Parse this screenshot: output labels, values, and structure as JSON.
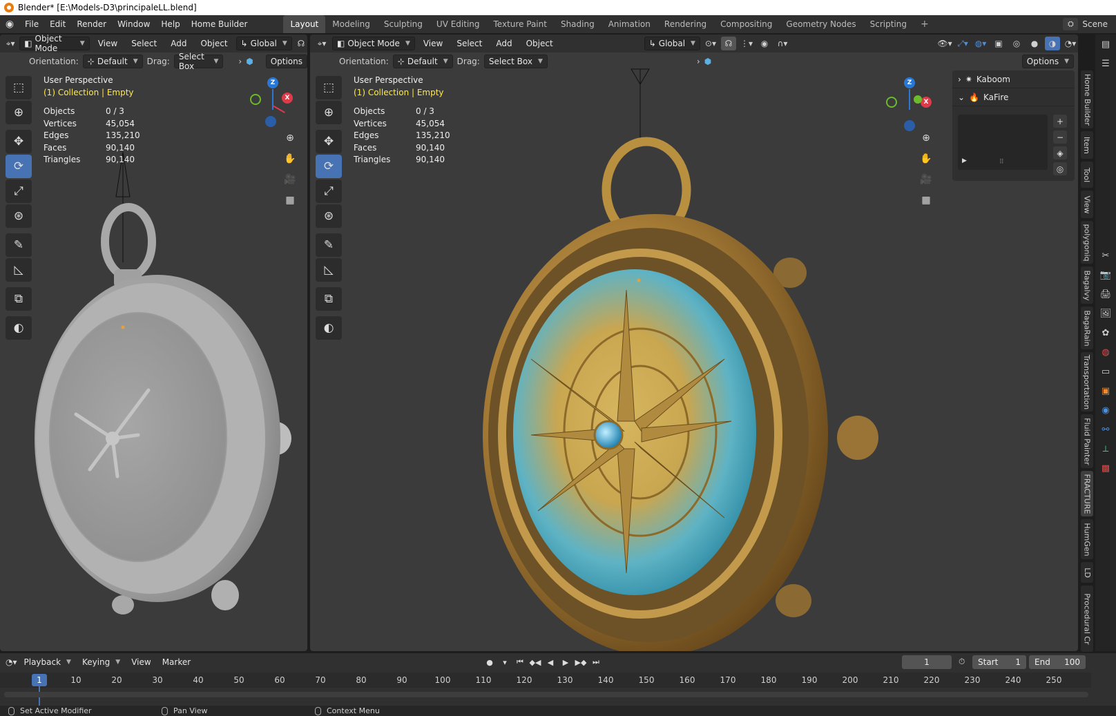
{
  "window_title": "Blender* [E:\\Models-D3\\principaleLL.blend]",
  "menu": [
    "File",
    "Edit",
    "Render",
    "Window",
    "Help",
    "Home Builder"
  ],
  "workspaces": [
    "Layout",
    "Modeling",
    "Sculpting",
    "UV Editing",
    "Texture Paint",
    "Shading",
    "Animation",
    "Rendering",
    "Compositing",
    "Geometry Nodes",
    "Scripting"
  ],
  "active_workspace": "Layout",
  "scene_name": "Scene",
  "viewport_left": {
    "mode": "Object Mode",
    "menus": [
      "View",
      "Select",
      "Add",
      "Object"
    ],
    "transform_orientation": "Global",
    "orientation_label": "Orientation:",
    "orientation_value": "Default",
    "drag_label": "Drag:",
    "drag_value": "Select Box",
    "options_label": "Options",
    "overlay_title": "User Perspective",
    "overlay_collection": "(1) Collection | Empty",
    "stats": [
      {
        "label": "Objects",
        "value": "0 / 3"
      },
      {
        "label": "Vertices",
        "value": "45,054"
      },
      {
        "label": "Edges",
        "value": "135,210"
      },
      {
        "label": "Faces",
        "value": "90,140"
      },
      {
        "label": "Triangles",
        "value": "90,140"
      }
    ]
  },
  "viewport_right": {
    "mode": "Object Mode",
    "menus": [
      "View",
      "Select",
      "Add",
      "Object"
    ],
    "transform_orientation": "Global",
    "orientation_label": "Orientation:",
    "orientation_value": "Default",
    "drag_label": "Drag:",
    "drag_value": "Select Box",
    "options_label": "Options",
    "overlay_title": "User Perspective",
    "overlay_collection": "(1) Collection | Empty",
    "stats": [
      {
        "label": "Objects",
        "value": "0 / 3"
      },
      {
        "label": "Vertices",
        "value": "45,054"
      },
      {
        "label": "Edges",
        "value": "135,210"
      },
      {
        "label": "Faces",
        "value": "90,140"
      },
      {
        "label": "Triangles",
        "value": "90,140"
      }
    ]
  },
  "gizmo_axes": {
    "z": "Z",
    "x": "X"
  },
  "npanel": {
    "items": [
      {
        "label": "Kaboom",
        "expanded": false
      },
      {
        "label": "KaFire",
        "expanded": true
      }
    ]
  },
  "sidebar_tabs": [
    "Home Builder",
    "Item",
    "Tool",
    "View",
    "polygoniq",
    "Bagalvy",
    "BagaRain",
    "Transportation",
    "Fluid Painter",
    "FRACTURE",
    "HumGen",
    "LD",
    "Procedural Cr"
  ],
  "timeline": {
    "menus": [
      "Playback",
      "Keying",
      "View",
      "Marker"
    ],
    "current_frame": "1",
    "start_label": "Start",
    "start_value": "1",
    "end_label": "End",
    "end_value": "100",
    "ruler_current": "1",
    "ruler_ticks": [
      "10",
      "20",
      "30",
      "40",
      "50",
      "60",
      "70",
      "80",
      "90",
      "100",
      "110",
      "120",
      "130",
      "140",
      "150",
      "160",
      "170",
      "180",
      "190",
      "200",
      "210",
      "220",
      "230",
      "240",
      "250"
    ]
  },
  "statusbar": [
    "Set Active Modifier",
    "Pan View",
    "Context Menu"
  ],
  "colors": {
    "accent": "#4772b3",
    "collection_text": "#ffea45",
    "brass": "#b08a45",
    "clay": "#c8c8c8"
  }
}
